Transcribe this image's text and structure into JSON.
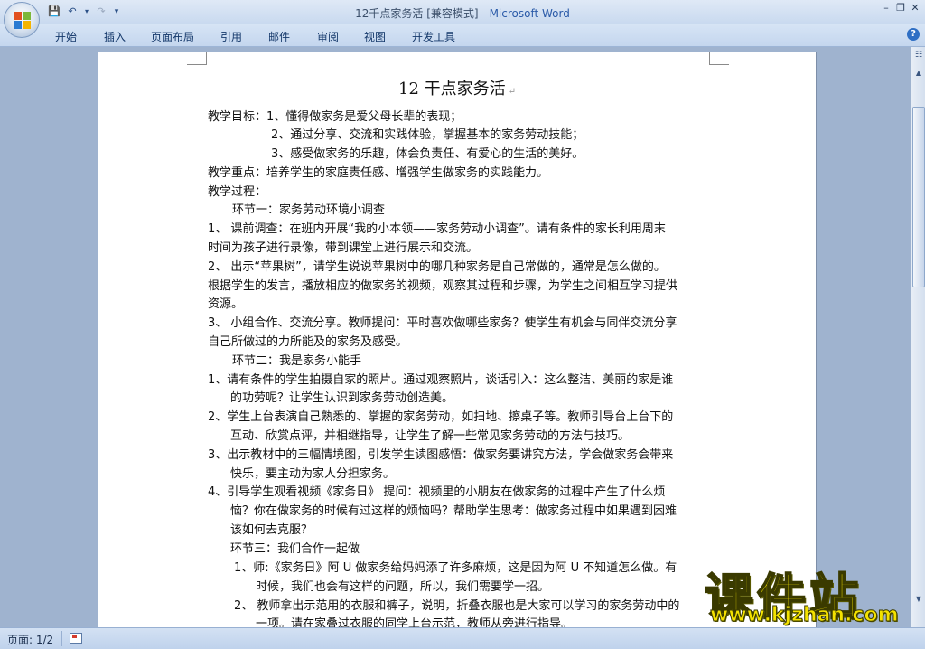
{
  "window": {
    "title_doc": "12千点家务活 [兼容模式] - ",
    "title_app": "Microsoft Word"
  },
  "qat": {
    "save_icon": "save-icon",
    "undo_icon": "undo-icon",
    "redo_icon": "redo-icon"
  },
  "tabs": [
    {
      "label": "开始"
    },
    {
      "label": "插入"
    },
    {
      "label": "页面布局"
    },
    {
      "label": "引用"
    },
    {
      "label": "邮件"
    },
    {
      "label": "审阅"
    },
    {
      "label": "视图"
    },
    {
      "label": "开发工具"
    }
  ],
  "document": {
    "title": "12 干点家务活",
    "lines": [
      "教学目标：1、懂得做家务是爱父母长辈的表现；",
      "2、通过分享、交流和实践体验，掌握基本的家务劳动技能；",
      "3、感受做家务的乐趣，体会负责任、有爱心的生活的美好。",
      "教学重点：培养学生的家庭责任感、增强学生做家务的实践能力。",
      "教学过程：",
      "环节一：家务劳动环境小调查",
      "1、 课前调查：在班内开展“我的小本领——家务劳动小调查”。请有条件的家长利用周末",
      "时间为孩子进行录像，带到课堂上进行展示和交流。",
      "2、 出示“苹果树”，请学生说说苹果树中的哪几种家务是自己常做的，通常是怎么做的。",
      "根据学生的发言，播放相应的做家务的视频，观察其过程和步骤，为学生之间相互学习提供",
      "资源。",
      "3、 小组合作、交流分享。教师提问：平时喜欢做哪些家务？使学生有机会与同伴交流分享",
      "自己所做过的力所能及的家务及感受。",
      "环节二：我是家务小能手",
      "1、请有条件的学生拍摄自家的照片。通过观察照片，谈话引入：这么整洁、美丽的家是谁",
      "的功劳呢？让学生认识到家务劳动创造美。",
      "2、学生上台表演自己熟悉的、掌握的家务劳动，如扫地、擦桌子等。教师引导台上台下的",
      "互动、欣赏点评，并相继指导，让学生了解一些常见家务劳动的方法与技巧。",
      "3、出示教材中的三幅情境图，引发学生读图感悟：做家务要讲究方法，学会做家务会带来",
      "快乐，要主动为家人分担家务。",
      "4、引导学生观看视频《家务日》 提问：视频里的小朋友在做家务的过程中产生了什么烦",
      "恼？你在做家务的时候有过这样的烦恼吗？帮助学生思考：做家务过程中如果遇到困难",
      "该如何去克服？",
      "环节三：我们合作一起做",
      "1、师:《家务日》阿 U 做家务给妈妈添了许多麻烦，这是因为阿 U 不知道怎么做。有",
      "时候，我们也会有这样的问题，所以，我们需要学一招。",
      "2、 教师拿出示范用的衣服和裤子，说明，折叠衣服也是大家可以学习的家务劳动中的",
      "一项。请在家叠过衣服的同学上台示范，教师从旁进行指导。"
    ]
  },
  "status": {
    "page": "页面: 1/2"
  },
  "watermark": {
    "cn": "课件站",
    "url": "www.kjzhan.com"
  }
}
